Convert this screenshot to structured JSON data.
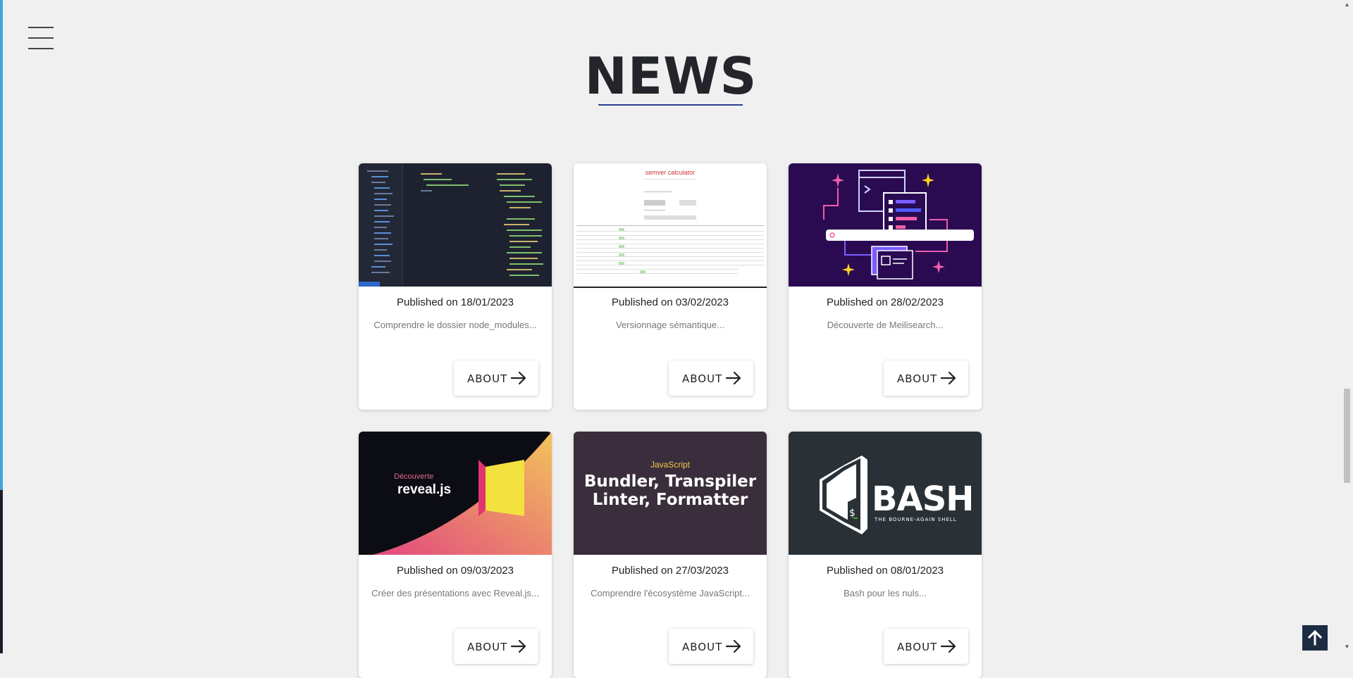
{
  "page": {
    "title": "NEWS",
    "accent_color": "#2b3d8f"
  },
  "menu": {
    "icon": "hamburger-icon"
  },
  "articles": [
    {
      "published": "Published on 18/01/2023",
      "excerpt": "Comprendre le dossier node_modules...",
      "button": "ABOUT",
      "thumb": "code-editor-screenshot"
    },
    {
      "published": "Published on 03/02/2023",
      "excerpt": "Versionnage sémantique...",
      "button": "ABOUT",
      "thumb": "semver-calculator-screenshot",
      "thumb_title": "semver calculator"
    },
    {
      "published": "Published on 28/02/2023",
      "excerpt": "Découverte de Meilisearch...",
      "button": "ABOUT",
      "thumb": "search-illustration"
    },
    {
      "published": "Published on 09/03/2023",
      "excerpt": "Créer des présentations avec Reveal.js...",
      "button": "ABOUT",
      "thumb": "revealjs-banner",
      "thumb_small": "Découverte",
      "thumb_big": "reveal.js"
    },
    {
      "published": "Published on 27/03/2023",
      "excerpt": "Comprendre l'écosystème JavaScript...",
      "button": "ABOUT",
      "thumb": "javascript-tools-banner",
      "thumb_small": "JavaScript",
      "thumb_line1": "Bundler, Transpiler",
      "thumb_line2": "Linter, Formatter"
    },
    {
      "published": "Published on 08/01/2023",
      "excerpt": "Bash pour les nuls...",
      "button": "ABOUT",
      "thumb": "bash-logo",
      "thumb_big": "BASH",
      "thumb_sub": "THE BOURNE-AGAIN SHELL"
    }
  ],
  "scroll_top": {
    "icon": "arrow-up-icon"
  }
}
